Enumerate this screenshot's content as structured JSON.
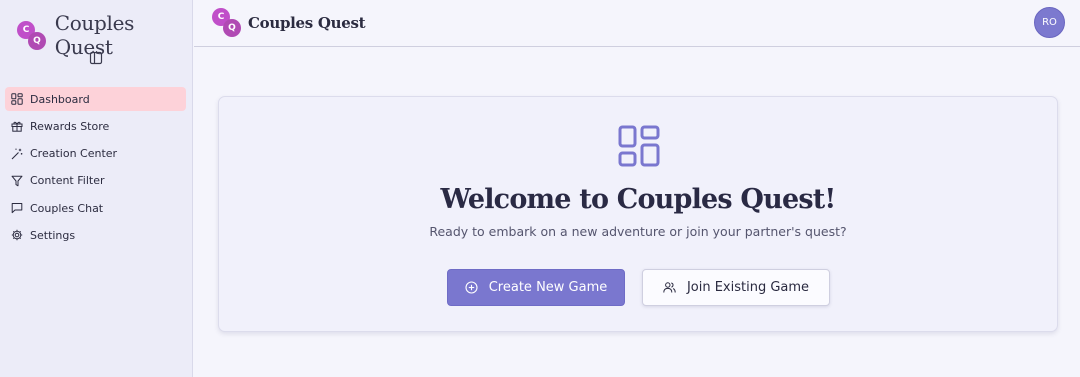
{
  "app": {
    "name": "Couples Quest",
    "logo_letters": [
      "C",
      "Q"
    ]
  },
  "sidebar": {
    "items": [
      {
        "label": "Dashboard",
        "icon": "grid-icon",
        "active": true
      },
      {
        "label": "Rewards Store",
        "icon": "gift-icon",
        "active": false
      },
      {
        "label": "Creation Center",
        "icon": "magic-wand-icon",
        "active": false
      },
      {
        "label": "Content Filter",
        "icon": "filter-icon",
        "active": false
      },
      {
        "label": "Couples Chat",
        "icon": "chat-icon",
        "active": false
      },
      {
        "label": "Settings",
        "icon": "gear-icon",
        "active": false
      }
    ]
  },
  "header": {
    "title": "Couples Quest",
    "avatar_initials": "RO"
  },
  "main": {
    "hero_icon": "dashboard-grid-icon",
    "title": "Welcome to Couples Quest!",
    "subtitle": "Ready to embark on a new adventure or join your partner's quest?",
    "create_label": "Create New Game",
    "join_label": "Join Existing Game"
  },
  "colors": {
    "accent": "#7a77cf",
    "active_nav": "#fdd2d9",
    "logo_pink": "#c04fc9"
  }
}
